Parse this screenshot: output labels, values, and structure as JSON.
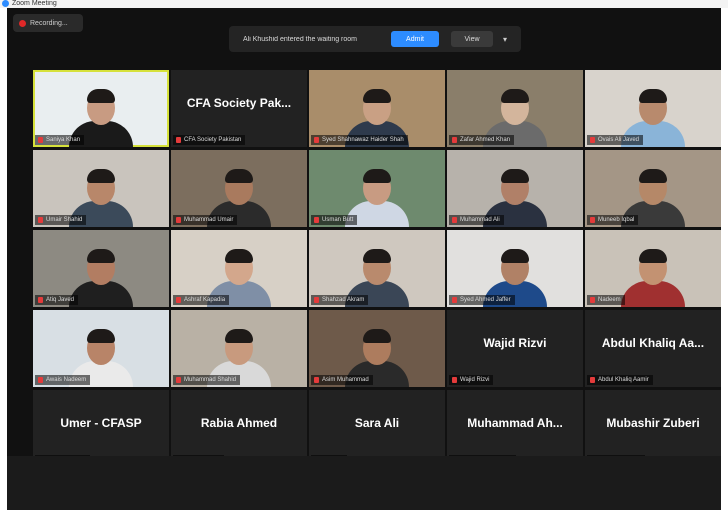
{
  "window": {
    "title": "Zoom Meeting"
  },
  "recording": {
    "label": "Recording..."
  },
  "notification": {
    "message": "Ali Khushid entered the waiting room",
    "admit_label": "Admit",
    "view_label": "View",
    "more_icon": "chevron-down-icon"
  },
  "colors": {
    "accent": "#2d8cff",
    "active_speaker": "#d6e13b",
    "muted": "#e43b3b"
  },
  "participants": [
    {
      "label": "Saniya Khan",
      "video": true,
      "bg": "#e9eef0",
      "skin": "#c89b82",
      "shirt": "#1a1a1a"
    },
    {
      "label": "CFA Society Pakistan",
      "video": false,
      "display": "CFA Society Pak..."
    },
    {
      "label": "Syed Shahnawaz Haider Shah",
      "video": true,
      "bg": "#a98d6a",
      "skin": "#c9a084",
      "shirt": "#2e3a4c"
    },
    {
      "label": "Zafar Ahmed Khan",
      "video": true,
      "bg": "#8a7e6a",
      "skin": "#d3b59c",
      "shirt": "#6b6b6b"
    },
    {
      "label": "Ovais Ali Javed",
      "video": true,
      "bg": "#d8d3cc",
      "skin": "#b88a6d",
      "shirt": "#8ab4d8"
    },
    {
      "label": "Umair Shahid",
      "video": true,
      "bg": "#c9c4bd",
      "skin": "#b8876a",
      "shirt": "#3b4a5a"
    },
    {
      "label": "Muhammad Umair",
      "video": true,
      "bg": "#7c6e5e",
      "skin": "#a97a5e",
      "shirt": "#2b2b2b"
    },
    {
      "label": "Usman Butt",
      "video": true,
      "bg": "#6e8a6e",
      "skin": "#c89b82",
      "shirt": "#cfd7e4"
    },
    {
      "label": "Muhammad Ali",
      "video": true,
      "bg": "#b7b2ab",
      "skin": "#b08068",
      "shirt": "#2a3140"
    },
    {
      "label": "Muneeb Iqbal",
      "video": true,
      "bg": "#a49686",
      "skin": "#b58868",
      "shirt": "#3a3a3a"
    },
    {
      "label": "Atiq Javed",
      "video": true,
      "bg": "#8d8a82",
      "skin": "#b27d62",
      "shirt": "#1f1f1f"
    },
    {
      "label": "Ashraf Kapadia",
      "video": true,
      "bg": "#d7d0c6",
      "skin": "#d3a78c",
      "shirt": "#7f8fa6"
    },
    {
      "label": "Shahzad Akram",
      "video": true,
      "bg": "#cfc8bf",
      "skin": "#b98a6d",
      "shirt": "#3a4656"
    },
    {
      "label": "Syed Ahmed Jaffer",
      "video": true,
      "bg": "#e1e0de",
      "skin": "#b08166",
      "shirt": "#1e4a8a"
    },
    {
      "label": "Nadeem",
      "video": true,
      "bg": "#c9c2b8",
      "skin": "#c39272",
      "shirt": "#a03030"
    },
    {
      "label": "Awais Nadeem",
      "video": true,
      "bg": "#d8dfe4",
      "skin": "#b88468",
      "shirt": "#eaeaea"
    },
    {
      "label": "Muhammad Shahid",
      "video": true,
      "bg": "#b9b1a5",
      "skin": "#c89a7e",
      "shirt": "#d9d9d9"
    },
    {
      "label": "Asim Muhammad",
      "video": true,
      "bg": "#6e5a4a",
      "skin": "#ad7c5e",
      "shirt": "#2a2a2a"
    },
    {
      "label": "Wajid Rizvi",
      "video": false,
      "display": "Wajid Rizvi"
    },
    {
      "label": "Abdul Khaliq Aamir",
      "video": false,
      "display": "Abdul Khaliq Aa..."
    },
    {
      "label": "Umer - CFASP",
      "video": false,
      "display": "Umer - CFASP"
    },
    {
      "label": "Rabia Ahmed",
      "video": false,
      "display": "Rabia Ahmed"
    },
    {
      "label": "Sara Ali",
      "video": false,
      "display": "Sara Ali"
    },
    {
      "label": "Muhammad Ahmed",
      "video": false,
      "display": "Muhammad Ah..."
    },
    {
      "label": "Mubashir Zuberi",
      "video": false,
      "display": "Mubashir Zuberi"
    }
  ]
}
